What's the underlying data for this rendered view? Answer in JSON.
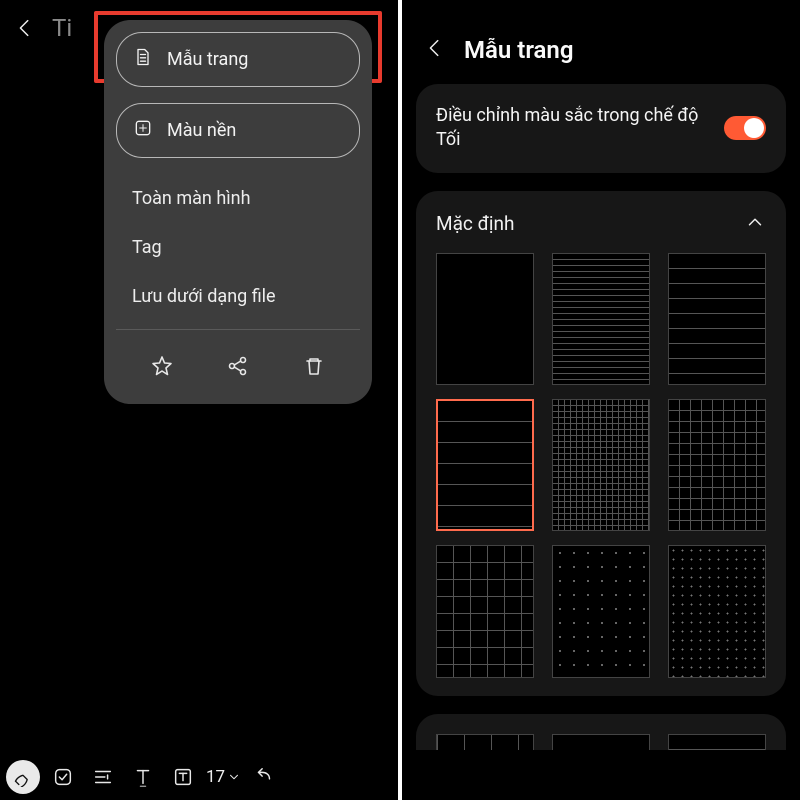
{
  "left": {
    "title_stub": "Ti",
    "menu": {
      "page_template_label": "Mẫu trang",
      "bg_color_label": "Màu nền",
      "fullscreen_label": "Toàn màn hình",
      "tag_label": "Tag",
      "save_as_file_label": "Lưu dưới dạng file"
    },
    "toolbar": {
      "zoom_label": "17"
    }
  },
  "right": {
    "header_title": "Mẫu trang",
    "dark_adjust_label": "Điều chỉnh  màu sắc  trong  chế  độ Tối",
    "dark_adjust_on": true,
    "section_default_label": "Mặc định",
    "templates": [
      {
        "name": "blank",
        "pattern": "",
        "selected": false
      },
      {
        "name": "hlines-fine",
        "pattern": "pat-hlines-fine",
        "selected": false
      },
      {
        "name": "hlines-wide",
        "pattern": "pat-hlines-wide",
        "selected": false
      },
      {
        "name": "hlines-tall",
        "pattern": "pat-hlines-tall",
        "selected": true
      },
      {
        "name": "grid-fine",
        "pattern": "pat-grid-fine",
        "selected": false
      },
      {
        "name": "grid-med",
        "pattern": "pat-grid-med",
        "selected": false
      },
      {
        "name": "grid-wide",
        "pattern": "pat-grid-wide",
        "selected": false
      },
      {
        "name": "dots",
        "pattern": "pat-dots",
        "selected": false
      },
      {
        "name": "dots-small",
        "pattern": "pat-dots-sm",
        "selected": false
      }
    ],
    "partial_templates": [
      {
        "name": "dash-grid",
        "pattern": "pat-dashgrid"
      },
      {
        "name": "checkbox-list",
        "pattern": "pat-checkbox-list"
      },
      {
        "name": "list-lines",
        "pattern": "pat-hlines-wide"
      }
    ]
  }
}
